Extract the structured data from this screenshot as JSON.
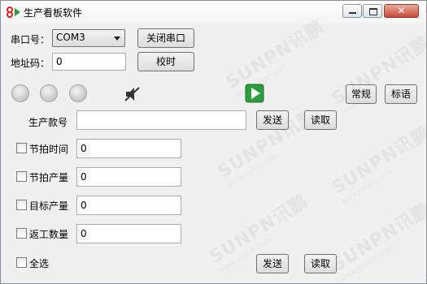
{
  "window": {
    "title": "生产看板软件"
  },
  "controls": {
    "port_label": "串口号：",
    "port_value": "COM3",
    "close_port_button": "关闭串口",
    "address_label": "地址码：",
    "address_value": "0",
    "time_sync_button": "校时",
    "normal_button": "常规",
    "tagline_button": "标语",
    "product_label": "生产款号",
    "product_value": "",
    "send_button": "发送",
    "read_button": "读取"
  },
  "fields": [
    {
      "label": "节拍时间",
      "value": "0"
    },
    {
      "label": "节拍产量",
      "value": "0"
    },
    {
      "label": "目标产量",
      "value": "0"
    },
    {
      "label": "返工数量",
      "value": "0"
    }
  ],
  "select_all": {
    "label": "全选"
  },
  "bottom": {
    "send_button": "发送",
    "read_button": "读取"
  },
  "watermark": {
    "brand": "SUNPN讯鹏",
    "url": "www.sunpn.com"
  },
  "colors": {
    "play_icon": "#34a853",
    "close_button": "#c74a37"
  }
}
